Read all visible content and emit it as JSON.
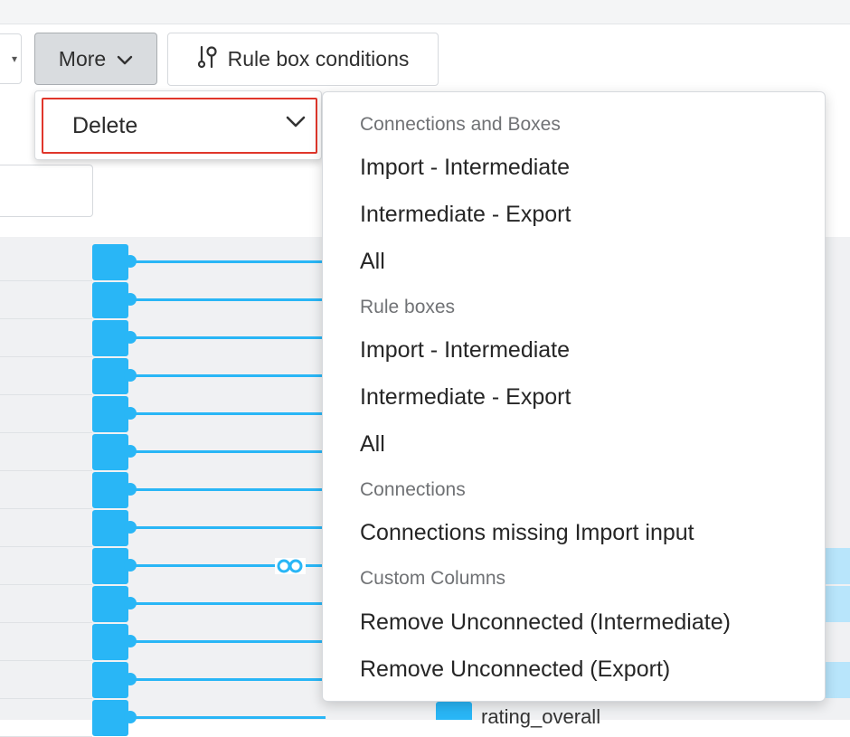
{
  "toolbar": {
    "more_label": "More",
    "rule_box_label": "Rule box conditions"
  },
  "delete_select": {
    "value": "Delete"
  },
  "menu": {
    "sections": [
      {
        "header": "Connections and Boxes",
        "items": [
          "Import - Intermediate",
          "Intermediate - Export",
          "All"
        ]
      },
      {
        "header": "Rule boxes",
        "items": [
          "Import - Intermediate",
          "Intermediate - Export",
          "All"
        ]
      },
      {
        "header": "Connections",
        "items": [
          "Connections missing Import input"
        ]
      },
      {
        "header": "Custom Columns",
        "items": [
          "Remove Unconnected (Intermediate)",
          "Remove Unconnected (Export)"
        ]
      }
    ]
  },
  "background": {
    "bottom_field_label": "rating_overall"
  },
  "colors": {
    "accent": "#29b6f6",
    "highlight_border": "#e0362b",
    "menu_header": "#707275"
  },
  "icons": {
    "more_chevron": "chevron-down-icon",
    "rule_box": "rule-conditions-icon",
    "delete_chevron": "chevron-down-icon",
    "loop": "loop-icon"
  }
}
